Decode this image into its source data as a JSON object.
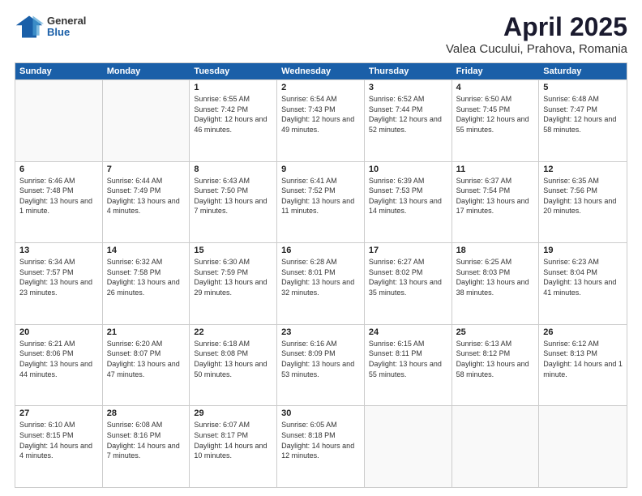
{
  "header": {
    "logo": {
      "general": "General",
      "blue": "Blue"
    },
    "title": "April 2025",
    "subtitle": "Valea Cucului, Prahova, Romania"
  },
  "calendar": {
    "days": [
      "Sunday",
      "Monday",
      "Tuesday",
      "Wednesday",
      "Thursday",
      "Friday",
      "Saturday"
    ],
    "weeks": [
      [
        {
          "day": "",
          "empty": true
        },
        {
          "day": "",
          "empty": true
        },
        {
          "day": "1",
          "sunrise": "Sunrise: 6:55 AM",
          "sunset": "Sunset: 7:42 PM",
          "daylight": "Daylight: 12 hours and 46 minutes."
        },
        {
          "day": "2",
          "sunrise": "Sunrise: 6:54 AM",
          "sunset": "Sunset: 7:43 PM",
          "daylight": "Daylight: 12 hours and 49 minutes."
        },
        {
          "day": "3",
          "sunrise": "Sunrise: 6:52 AM",
          "sunset": "Sunset: 7:44 PM",
          "daylight": "Daylight: 12 hours and 52 minutes."
        },
        {
          "day": "4",
          "sunrise": "Sunrise: 6:50 AM",
          "sunset": "Sunset: 7:45 PM",
          "daylight": "Daylight: 12 hours and 55 minutes."
        },
        {
          "day": "5",
          "sunrise": "Sunrise: 6:48 AM",
          "sunset": "Sunset: 7:47 PM",
          "daylight": "Daylight: 12 hours and 58 minutes."
        }
      ],
      [
        {
          "day": "6",
          "sunrise": "Sunrise: 6:46 AM",
          "sunset": "Sunset: 7:48 PM",
          "daylight": "Daylight: 13 hours and 1 minute."
        },
        {
          "day": "7",
          "sunrise": "Sunrise: 6:44 AM",
          "sunset": "Sunset: 7:49 PM",
          "daylight": "Daylight: 13 hours and 4 minutes."
        },
        {
          "day": "8",
          "sunrise": "Sunrise: 6:43 AM",
          "sunset": "Sunset: 7:50 PM",
          "daylight": "Daylight: 13 hours and 7 minutes."
        },
        {
          "day": "9",
          "sunrise": "Sunrise: 6:41 AM",
          "sunset": "Sunset: 7:52 PM",
          "daylight": "Daylight: 13 hours and 11 minutes."
        },
        {
          "day": "10",
          "sunrise": "Sunrise: 6:39 AM",
          "sunset": "Sunset: 7:53 PM",
          "daylight": "Daylight: 13 hours and 14 minutes."
        },
        {
          "day": "11",
          "sunrise": "Sunrise: 6:37 AM",
          "sunset": "Sunset: 7:54 PM",
          "daylight": "Daylight: 13 hours and 17 minutes."
        },
        {
          "day": "12",
          "sunrise": "Sunrise: 6:35 AM",
          "sunset": "Sunset: 7:56 PM",
          "daylight": "Daylight: 13 hours and 20 minutes."
        }
      ],
      [
        {
          "day": "13",
          "sunrise": "Sunrise: 6:34 AM",
          "sunset": "Sunset: 7:57 PM",
          "daylight": "Daylight: 13 hours and 23 minutes."
        },
        {
          "day": "14",
          "sunrise": "Sunrise: 6:32 AM",
          "sunset": "Sunset: 7:58 PM",
          "daylight": "Daylight: 13 hours and 26 minutes."
        },
        {
          "day": "15",
          "sunrise": "Sunrise: 6:30 AM",
          "sunset": "Sunset: 7:59 PM",
          "daylight": "Daylight: 13 hours and 29 minutes."
        },
        {
          "day": "16",
          "sunrise": "Sunrise: 6:28 AM",
          "sunset": "Sunset: 8:01 PM",
          "daylight": "Daylight: 13 hours and 32 minutes."
        },
        {
          "day": "17",
          "sunrise": "Sunrise: 6:27 AM",
          "sunset": "Sunset: 8:02 PM",
          "daylight": "Daylight: 13 hours and 35 minutes."
        },
        {
          "day": "18",
          "sunrise": "Sunrise: 6:25 AM",
          "sunset": "Sunset: 8:03 PM",
          "daylight": "Daylight: 13 hours and 38 minutes."
        },
        {
          "day": "19",
          "sunrise": "Sunrise: 6:23 AM",
          "sunset": "Sunset: 8:04 PM",
          "daylight": "Daylight: 13 hours and 41 minutes."
        }
      ],
      [
        {
          "day": "20",
          "sunrise": "Sunrise: 6:21 AM",
          "sunset": "Sunset: 8:06 PM",
          "daylight": "Daylight: 13 hours and 44 minutes."
        },
        {
          "day": "21",
          "sunrise": "Sunrise: 6:20 AM",
          "sunset": "Sunset: 8:07 PM",
          "daylight": "Daylight: 13 hours and 47 minutes."
        },
        {
          "day": "22",
          "sunrise": "Sunrise: 6:18 AM",
          "sunset": "Sunset: 8:08 PM",
          "daylight": "Daylight: 13 hours and 50 minutes."
        },
        {
          "day": "23",
          "sunrise": "Sunrise: 6:16 AM",
          "sunset": "Sunset: 8:09 PM",
          "daylight": "Daylight: 13 hours and 53 minutes."
        },
        {
          "day": "24",
          "sunrise": "Sunrise: 6:15 AM",
          "sunset": "Sunset: 8:11 PM",
          "daylight": "Daylight: 13 hours and 55 minutes."
        },
        {
          "day": "25",
          "sunrise": "Sunrise: 6:13 AM",
          "sunset": "Sunset: 8:12 PM",
          "daylight": "Daylight: 13 hours and 58 minutes."
        },
        {
          "day": "26",
          "sunrise": "Sunrise: 6:12 AM",
          "sunset": "Sunset: 8:13 PM",
          "daylight": "Daylight: 14 hours and 1 minute."
        }
      ],
      [
        {
          "day": "27",
          "sunrise": "Sunrise: 6:10 AM",
          "sunset": "Sunset: 8:15 PM",
          "daylight": "Daylight: 14 hours and 4 minutes."
        },
        {
          "day": "28",
          "sunrise": "Sunrise: 6:08 AM",
          "sunset": "Sunset: 8:16 PM",
          "daylight": "Daylight: 14 hours and 7 minutes."
        },
        {
          "day": "29",
          "sunrise": "Sunrise: 6:07 AM",
          "sunset": "Sunset: 8:17 PM",
          "daylight": "Daylight: 14 hours and 10 minutes."
        },
        {
          "day": "30",
          "sunrise": "Sunrise: 6:05 AM",
          "sunset": "Sunset: 8:18 PM",
          "daylight": "Daylight: 14 hours and 12 minutes."
        },
        {
          "day": "",
          "empty": true
        },
        {
          "day": "",
          "empty": true
        },
        {
          "day": "",
          "empty": true
        }
      ]
    ]
  }
}
